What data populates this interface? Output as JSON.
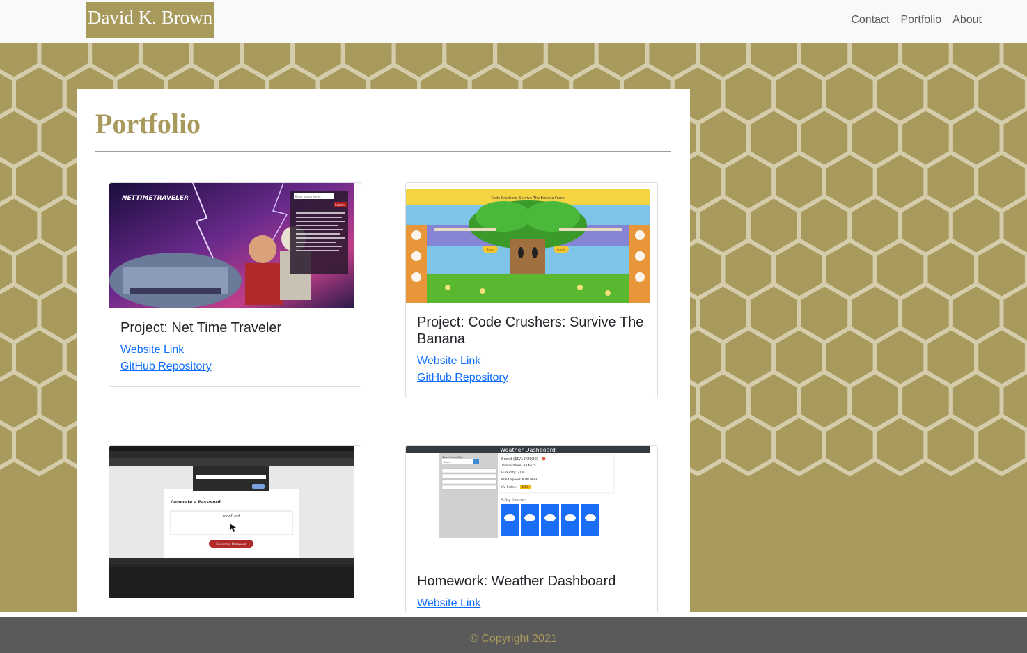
{
  "navbar": {
    "brand": "David K. Brown",
    "links": [
      "Contact",
      "Portfolio",
      "About"
    ]
  },
  "page": {
    "title": "Portfolio"
  },
  "projects": [
    {
      "title": "Project: Net Time Traveler",
      "website_label": "Website Link",
      "github_label": "GitHub Repository",
      "thumb": {
        "logo": "NETTIMETRAVELER",
        "search_placeholder": "Enter a year here...",
        "search_button": "Search"
      }
    },
    {
      "title": "Project: Code Crushers: Survive The Banana",
      "website_label": "Website Link",
      "github_label": "GitHub Repository",
      "thumb": {
        "banner": "Code Crushers: Survive The Banana Force",
        "btn_left": "Start",
        "btn_right": "Admin"
      }
    },
    {
      "title": "",
      "website_label": "",
      "github_label": "",
      "thumb": {
        "heading": "Generate a Password",
        "password": "sodef1ord",
        "button": "Generate Password"
      }
    },
    {
      "title": "Homework: Weather Dashboard",
      "website_label": "Website Link",
      "github_label": "",
      "thumb": {
        "header": "Weather Dashboard",
        "search_label": "Search for a City:",
        "search_value": "Seoul",
        "city_line": "Seoul (10/15/2020)",
        "temp": "Temperature: 83.66 °F",
        "humidity": "Humidity: 21%",
        "wind": "Wind Speed: 8.08 MPH",
        "uv_label": "UV Index:",
        "uv_value": "4.09",
        "forecast_label": "5-Day Forecast:"
      }
    }
  ],
  "footer": {
    "text": "© Copyright 2021"
  },
  "colors": {
    "accent": "#a89a5c",
    "link": "#0d6efd",
    "footer_bg": "#5a5a5a",
    "nav_bg": "#f8f9fa"
  }
}
